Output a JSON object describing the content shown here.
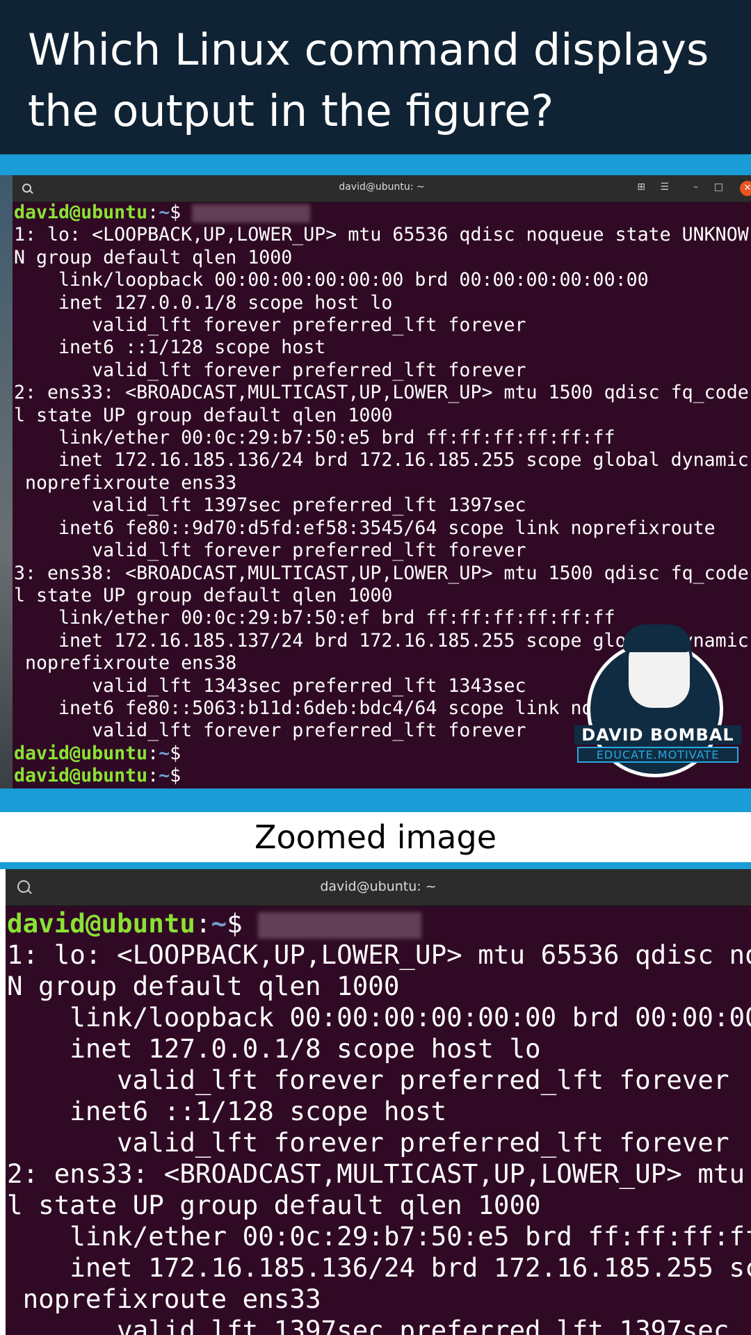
{
  "question": "Which Linux command displays\nthe output in the figure?",
  "zoom_label": "Zoomed image",
  "window_title": "david@ubuntu: ~",
  "prompt": {
    "user": "david@ubuntu",
    "sep": ":",
    "path": "~",
    "dollar": "$"
  },
  "output_lines": [
    "1: lo: <LOOPBACK,UP,LOWER_UP> mtu 65536 qdisc noqueue state UNKNOW",
    "N group default qlen 1000",
    "    link/loopback 00:00:00:00:00:00 brd 00:00:00:00:00:00",
    "    inet 127.0.0.1/8 scope host lo",
    "       valid_lft forever preferred_lft forever",
    "    inet6 ::1/128 scope host",
    "       valid_lft forever preferred_lft forever",
    "2: ens33: <BROADCAST,MULTICAST,UP,LOWER_UP> mtu 1500 qdisc fq_code",
    "l state UP group default qlen 1000",
    "    link/ether 00:0c:29:b7:50:e5 brd ff:ff:ff:ff:ff:ff",
    "    inet 172.16.185.136/24 brd 172.16.185.255 scope global dynamic",
    " noprefixroute ens33",
    "       valid_lft 1397sec preferred_lft 1397sec",
    "    inet6 fe80::9d70:d5fd:ef58:3545/64 scope link noprefixroute",
    "       valid_lft forever preferred_lft forever",
    "3: ens38: <BROADCAST,MULTICAST,UP,LOWER_UP> mtu 1500 qdisc fq_code",
    "l state UP group default qlen 1000",
    "    link/ether 00:0c:29:b7:50:ef brd ff:ff:ff:ff:ff:ff",
    "    inet 172.16.185.137/24 brd 172.16.185.255 scope global dynamic",
    " noprefixroute ens38",
    "       valid_lft 1343sec preferred_lft 1343sec",
    "    inet6 fe80::5063:b11d:6deb:bdc4/64 scope link noprefixroute",
    "       valid_lft forever preferred_lft forever"
  ],
  "zoom_line_count": 13,
  "trailing_prompts": 2,
  "logo": {
    "name": "DAVID BOMBAL",
    "tagline": "EDUCATE.MOTIVATE"
  },
  "icons": {
    "search": "search-icon",
    "new_tab": "new-tab-icon",
    "menu": "hamburger-menu-icon",
    "minimize": "minimize-icon",
    "maximize": "maximize-icon",
    "close": "close-icon"
  },
  "colors": {
    "header_bg": "#0f2334",
    "band": "#1a9cd6",
    "terminal_bg": "#300a24",
    "prompt_user": "#8ae234",
    "prompt_path": "#729fcf",
    "close_button": "#e95420"
  }
}
